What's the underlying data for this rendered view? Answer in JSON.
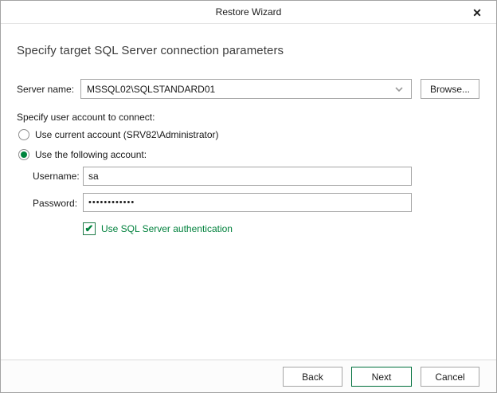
{
  "colors": {
    "accent_green": "#00843d",
    "next_button_border": "#00703c",
    "checkbox_label_green": "#00813c",
    "input_border_grey": "#a5a5a5"
  },
  "icons": {
    "close": "✕",
    "check": "✔",
    "chevron_down": "chevron-down"
  },
  "header": {
    "title": "Restore Wizard"
  },
  "main": {
    "heading": "Specify target SQL Server connection parameters",
    "server": {
      "label": "Server name:",
      "value": "MSSQL02\\SQLSTANDARD01",
      "browse_label": "Browse..."
    },
    "account_section": {
      "label": "Specify user account to connect:",
      "options": [
        {
          "label": "Use current account (SRV82\\Administrator)",
          "selected": false
        },
        {
          "label": "Use the following account:",
          "selected": true
        }
      ],
      "username": {
        "label": "Username:",
        "value": "sa"
      },
      "password": {
        "label": "Password:",
        "masked_value": "••••••••••••"
      },
      "sql_auth_checkbox": {
        "label": "Use SQL Server authentication",
        "checked": true
      }
    }
  },
  "footer": {
    "buttons": [
      {
        "label": "Back",
        "default": false
      },
      {
        "label": "Next",
        "default": true
      },
      {
        "label": "Cancel",
        "default": false
      }
    ]
  }
}
